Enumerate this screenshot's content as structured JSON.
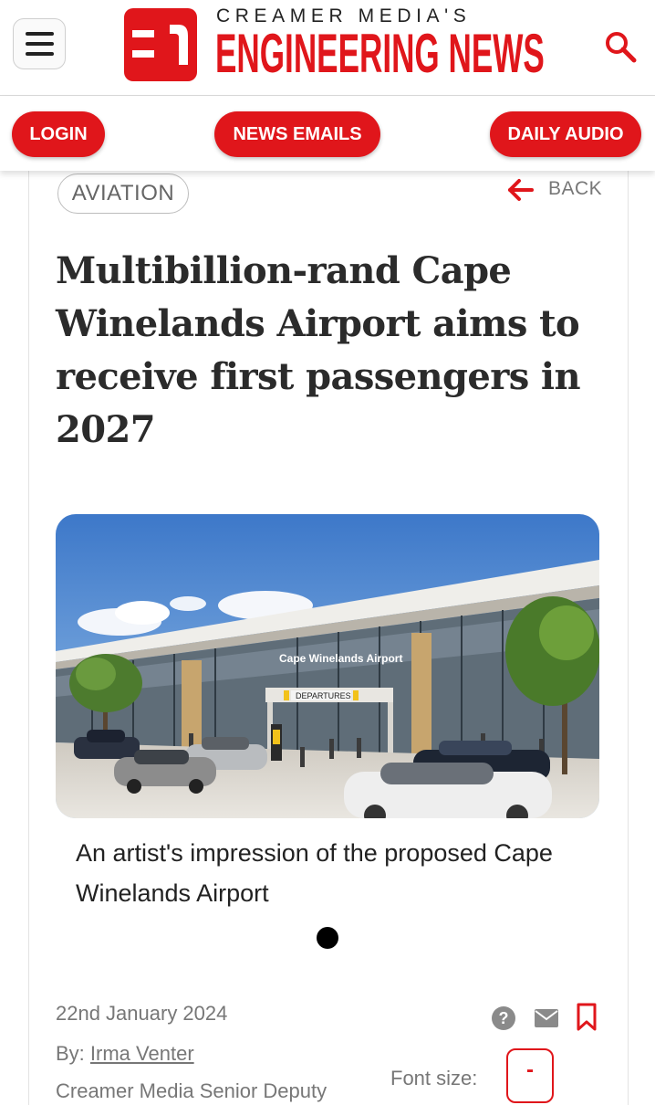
{
  "header": {
    "brand_top": "CREAMER MEDIA'S",
    "brand_main": "ENGINEERING NEWS",
    "brand_color": "#e0161b",
    "menu_icon": "hamburger-menu-icon",
    "search_icon": "search-icon"
  },
  "actions": {
    "login": "LOGIN",
    "news_emails": "NEWS EMAILS",
    "daily_audio": "DAILY AUDIO"
  },
  "article": {
    "category": "AVIATION",
    "back_label": "BACK",
    "title": "Multibillion-rand Cape Winelands Airport aims to receive first passengers in 2027",
    "image": {
      "sign_text": "Cape Winelands Airport",
      "departures_text": "DEPARTURES",
      "caption": "An artist's impression of the proposed Cape Winelands Airport"
    },
    "date": "22nd January 2024",
    "by_prefix": "By:",
    "author": "Irma Venter",
    "author_role": "Creamer Media Senior Deputy",
    "font_size_label": "Font size:",
    "font_size_decrease": "-"
  }
}
